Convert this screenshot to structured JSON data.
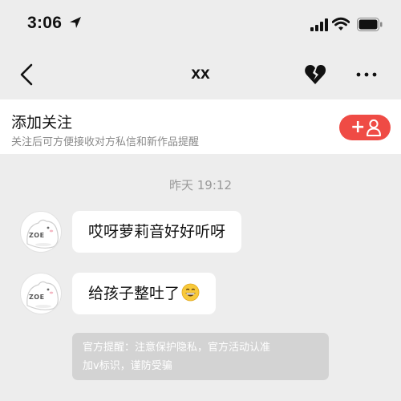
{
  "status_bar": {
    "time": "3:06"
  },
  "nav": {
    "title": "xx"
  },
  "follow": {
    "title": "添加关注",
    "subtitle": "关注后可方便接收对方私信和新作品提醒",
    "button_symbol": "+",
    "accent_color": "#ef4b45"
  },
  "chat": {
    "timestamp": "昨天 19:12",
    "messages": [
      {
        "avatar_label": "ZOE",
        "text": "哎呀萝莉音好好听呀",
        "emoji": ""
      },
      {
        "avatar_label": "ZOE",
        "text": "给孩子整吐了",
        "emoji": "grinning-face-icon"
      }
    ],
    "notice": {
      "line1": "官方提醒：注意保护隐私，官方活动认准",
      "line2": "加v标识，谨防受骗"
    }
  }
}
